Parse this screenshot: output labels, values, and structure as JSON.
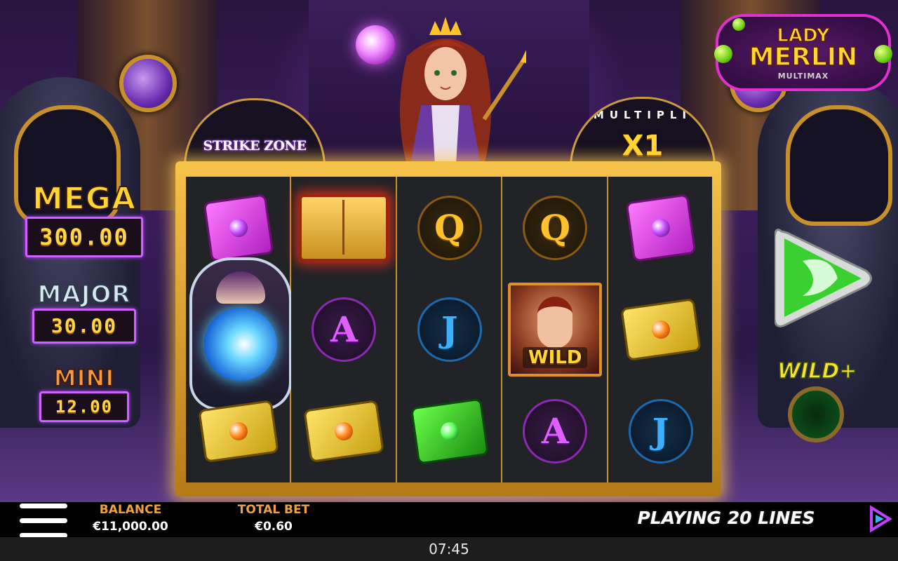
{
  "game": {
    "logo_line1": "LADY",
    "logo_line2": "MERLIN",
    "logo_line3": "MULTIMAX"
  },
  "strike_zone": {
    "label": "STRIKE ZONE"
  },
  "multiplier": {
    "ring_text": "MULTIPLI",
    "value": "X1"
  },
  "jackpots": {
    "mega": {
      "name": "MEGA",
      "value": "300.00"
    },
    "major": {
      "name": "MAJOR",
      "value": "30.00"
    },
    "mini": {
      "name": "MINI",
      "value": "12.00"
    }
  },
  "reels": [
    [
      "pink-book",
      "crystal-ball",
      "yellow-book"
    ],
    [
      "golden-open-book",
      "A",
      "yellow-book"
    ],
    [
      "Q",
      "J",
      "green-book"
    ],
    [
      "Q",
      "WILD",
      "A"
    ],
    [
      "pink-book",
      "yellow-book",
      "J"
    ]
  ],
  "symbols": {
    "q": "Q",
    "a": "A",
    "j": "J",
    "wild": "WILD"
  },
  "feature": {
    "wild_plus": "WILD+"
  },
  "bottom_bar": {
    "balance_label": "BALANCE",
    "balance_value": "€11,000.00",
    "bet_label": "TOTAL BET",
    "bet_value": "€0.60",
    "lines_text": "PLAYING 20 LINES"
  },
  "status": {
    "time": "07:45"
  },
  "colors": {
    "gold": "#ffd630",
    "frame": "#f6c34a",
    "spin_green": "#3ad030",
    "magenta": "#d060ff"
  }
}
